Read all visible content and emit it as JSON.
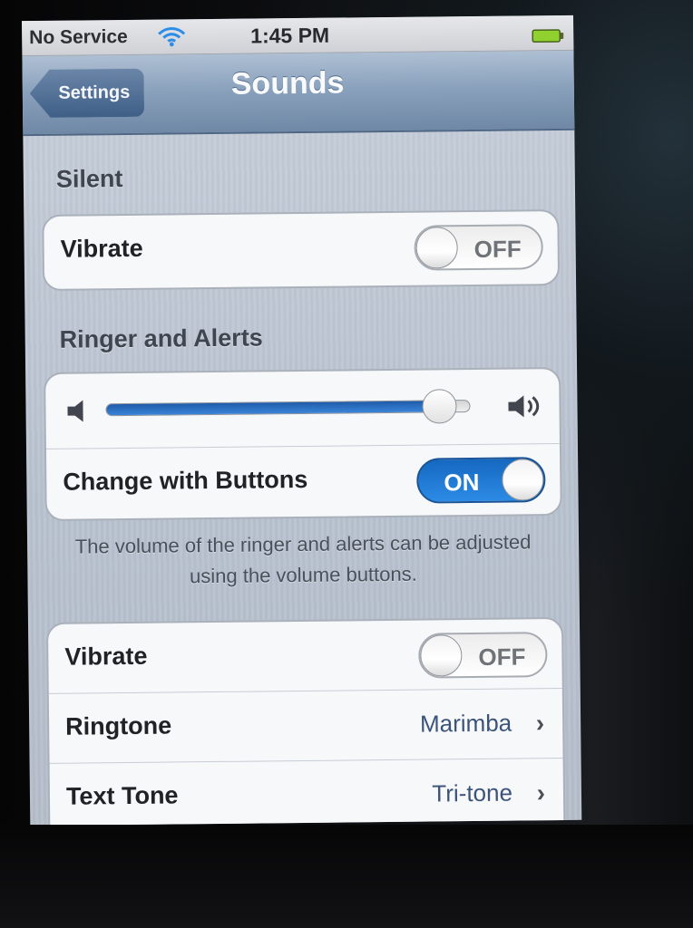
{
  "status_bar": {
    "carrier": "No Service",
    "time": "1:45 PM",
    "wifi_icon": "wifi-icon",
    "battery_icon": "battery-icon"
  },
  "nav": {
    "back_label": "Settings",
    "title": "Sounds"
  },
  "silent": {
    "header": "Silent",
    "vibrate_label": "Vibrate",
    "vibrate_state": "OFF"
  },
  "ringer": {
    "header": "Ringer and Alerts",
    "volume_level": 0.92,
    "change_label": "Change with Buttons",
    "change_state": "ON",
    "footer": "The volume of the ringer and alerts can be adjusted using the volume buttons."
  },
  "settings": {
    "vibrate_label": "Vibrate",
    "vibrate_state": "OFF",
    "ringtone_label": "Ringtone",
    "ringtone_value": "Marimba",
    "text_tone_label": "Text Tone",
    "text_tone_value": "Tri-tone"
  },
  "colors": {
    "nav_blue": "#7a92b0",
    "switch_blue": "#2c86e2",
    "group_white": "#f7f8fa"
  }
}
